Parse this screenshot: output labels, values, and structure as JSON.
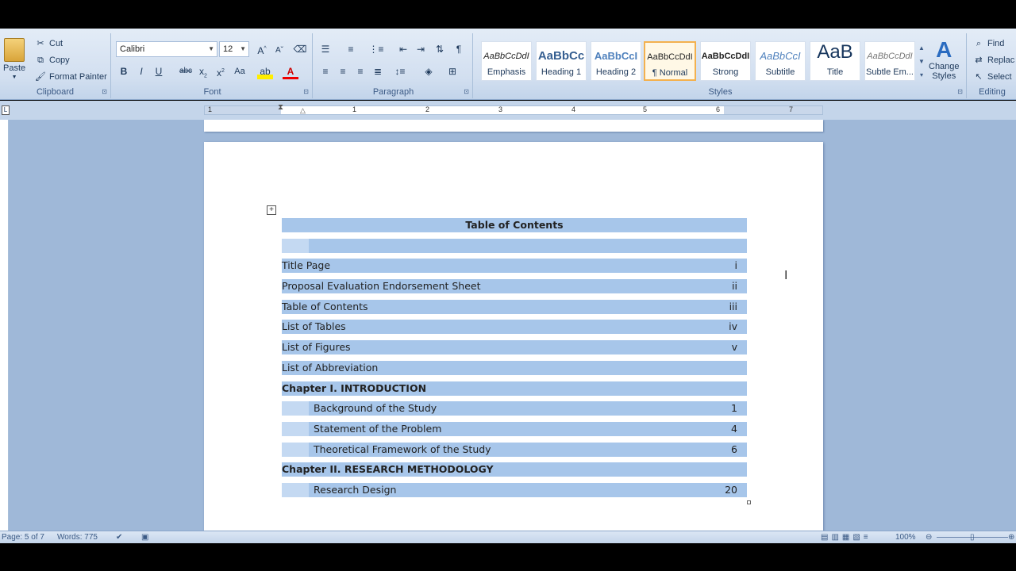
{
  "ribbon": {
    "clipboard": {
      "title": "Clipboard",
      "paste": "Paste",
      "cut": "Cut",
      "copy": "Copy",
      "format_painter": "Format Painter"
    },
    "font": {
      "title": "Font",
      "font_name": "Calibri",
      "font_size": "12"
    },
    "paragraph": {
      "title": "Paragraph"
    },
    "styles": {
      "title": "Styles",
      "items": [
        {
          "sample": "AaBbCcDdI",
          "name": "Emphasis"
        },
        {
          "sample": "AaBbCc",
          "name": "Heading 1"
        },
        {
          "sample": "AaBbCcI",
          "name": "Heading 2"
        },
        {
          "sample": "AaBbCcDdI",
          "name": "¶ Normal"
        },
        {
          "sample": "AaBbCcDdI",
          "name": "Strong"
        },
        {
          "sample": "AaBbCcI",
          "name": "Subtitle"
        },
        {
          "sample": "AaB",
          "name": "Title"
        },
        {
          "sample": "AaBbCcDdI",
          "name": "Subtle Em..."
        }
      ],
      "change_styles_line1": "Change",
      "change_styles_line2": "Styles"
    },
    "editing": {
      "title": "Editing",
      "find": "Find",
      "replace": "Replac",
      "select": "Select"
    }
  },
  "ruler": {
    "numbers": [
      "1",
      "1",
      "2",
      "3",
      "4",
      "5",
      "6",
      "7"
    ]
  },
  "toc": {
    "title": "Table of Contents",
    "rows": [
      {
        "text": "Title Page",
        "page": "i"
      },
      {
        "text": "Proposal Evaluation Endorsement Sheet",
        "page": "ii"
      },
      {
        "text": "Table of Contents",
        "page": "iii"
      },
      {
        "text": "List of Tables",
        "page": "iv"
      },
      {
        "text": "List of Figures",
        "page": "v"
      },
      {
        "text": "List of Abbreviation",
        "page": ""
      },
      {
        "text": "Chapter I. INTRODUCTION",
        "page": ""
      },
      {
        "text": "Background of the Study",
        "page": "1"
      },
      {
        "text": "Statement of the Problem",
        "page": "4"
      },
      {
        "text": "Theoretical Framework of the Study",
        "page": "6"
      },
      {
        "text": "Chapter II. RESEARCH METHODOLOGY",
        "page": ""
      },
      {
        "text": "Research Design",
        "page": "20"
      }
    ]
  },
  "status": {
    "page": "Page: 5 of 7",
    "words": "Words: 775",
    "zoom": "100%"
  }
}
